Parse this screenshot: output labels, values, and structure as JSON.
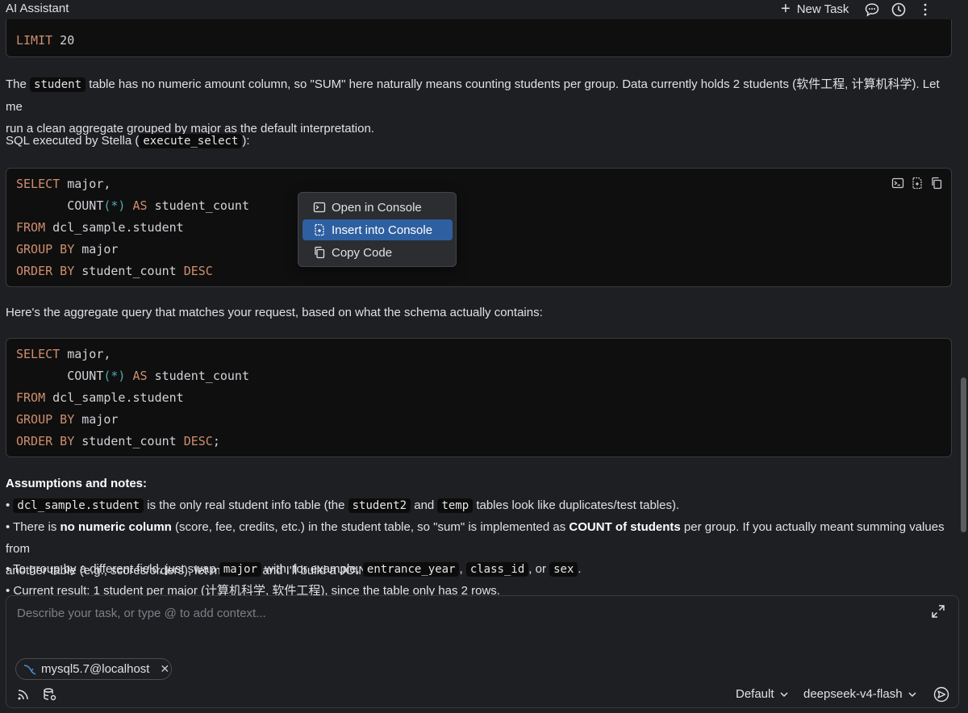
{
  "header": {
    "title": "AI Assistant",
    "new_task_label": "New Task",
    "icons": [
      "chat-icon",
      "history-icon",
      "more-vert-icon"
    ]
  },
  "code_block_0": {
    "lines": [
      "LIMIT 20"
    ]
  },
  "para_intro": {
    "t1": "The ",
    "code1": "student",
    "t2": " table has no numeric amount column, so \"SUM\" here naturally means counting students per group. Data currently holds 2 students (软件工程, 计算机科学). Let me",
    "t3": "run a clean aggregate grouped by major as the default interpretation."
  },
  "sql_executed": {
    "t1": "SQL executed by Stella (",
    "code": "execute_select",
    "t2": "):"
  },
  "code_block_1": {
    "kw_select": "SELECT",
    "l1_rest": " major,",
    "l2_fn": "       COUNT",
    "l2_paren": "(*)",
    "l2_as": " AS",
    "l2_rest": " student_count",
    "kw_from": "FROM",
    "l3_rest": " dcl_sample.student",
    "kw_group": "GROUP BY",
    "l4_rest": " major",
    "kw_order": "ORDER BY",
    "l5_rest": " student_count",
    "kw_desc": " DESC",
    "icons": [
      "terminal-icon",
      "insert-file-icon",
      "copy-icon"
    ]
  },
  "context_menu": {
    "items": [
      {
        "label": "Open in Console",
        "icon": "terminal-icon"
      },
      {
        "label": "Insert into Console",
        "icon": "insert-file-icon",
        "selected": true
      },
      {
        "label": "Copy Code",
        "icon": "copy-icon"
      }
    ]
  },
  "para_aggregate": "Here's the aggregate query that matches your request, based on what the schema actually contains:",
  "code_block_2": {
    "kw_select": "SELECT",
    "l1_rest": " major,",
    "l2_fn": "       COUNT",
    "l2_paren": "(*)",
    "l2_as": " AS",
    "l2_rest": " student_count",
    "kw_from": "FROM",
    "l3_rest": " dcl_sample.student",
    "kw_group": "GROUP BY",
    "l4_rest": " major",
    "kw_order": "ORDER BY",
    "l5_rest": " student_count",
    "kw_desc": " DESC",
    "l5_end": ";"
  },
  "notes": {
    "heading": "Assumptions and notes:",
    "b1": {
      "bullet": "• ",
      "code1": "dcl_sample.student",
      "t1": " is the only real student info table (the ",
      "code2": "student2",
      "t2": " and ",
      "code3": "temp",
      "t3": " tables look like duplicates/test tables)."
    },
    "b2": {
      "t1": "• There is ",
      "bold1": "no numeric column",
      "t2": " (score, fee, credits, etc.) in the student table, so \"sum\" is implemented as ",
      "bold2": "COUNT of students",
      "t3": " per group. If you actually meant summing values from",
      "t4": "another table (e.g., scores/orders), let me know and I'll build a JOIN-based SUM."
    },
    "b3": {
      "t1": "• To group by a different field, just swap ",
      "code1": "major",
      "t2": " with, for example, ",
      "code2": "entrance_year",
      "t3": ", ",
      "code3": "class_id",
      "t4": ", or ",
      "code4": "sex",
      "t5": "."
    },
    "b4": "• Current result: 1 student per major (计算机科学, 软件工程), since the table only has 2 rows."
  },
  "input": {
    "placeholder": "Describe your task, or type @ to add context...",
    "context_chip": "mysql5.7@localhost",
    "mode_label": "Default",
    "model_label": "deepseek-v4-flash"
  }
}
